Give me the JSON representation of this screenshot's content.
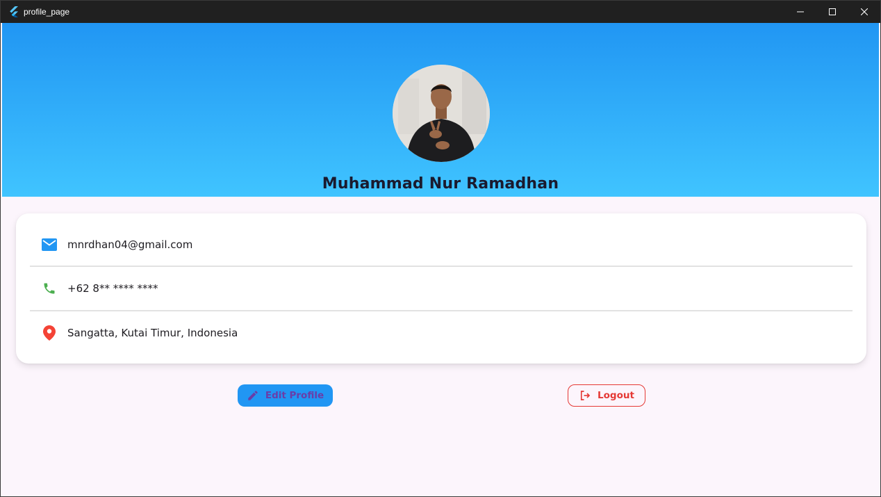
{
  "window": {
    "title": "profile_page",
    "controls": [
      "minimize-icon",
      "maximize-icon",
      "close-icon"
    ]
  },
  "header": {
    "gradient_top": "#2196f3",
    "gradient_bottom": "#40c4ff",
    "name": "Muhammad Nur Ramadhan"
  },
  "info": {
    "email": {
      "icon": "email-icon",
      "color": "#2196f3",
      "value": "mnrdhan04@gmail.com"
    },
    "phone": {
      "icon": "phone-icon",
      "color": "#4caf50",
      "value": "+62 8** **** ****"
    },
    "location": {
      "icon": "location-pin-icon",
      "color": "#f44336",
      "value": "Sangatta, Kutai Timur, Indonesia"
    }
  },
  "actions": {
    "edit_label": "Edit Profile",
    "edit_icon": "pencil-icon",
    "logout_label": "Logout",
    "logout_icon": "logout-icon",
    "accent": "#2196f3",
    "danger": "#e53935"
  }
}
